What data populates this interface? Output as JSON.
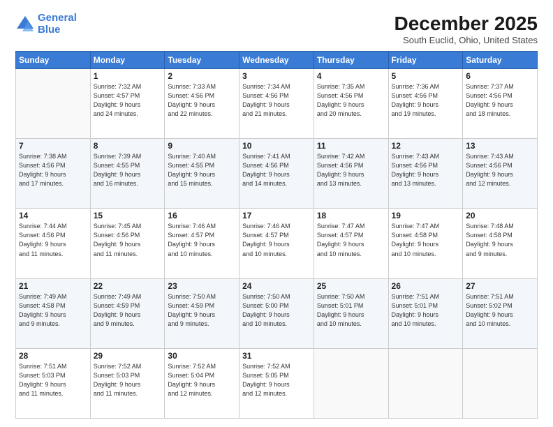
{
  "logo": {
    "line1": "General",
    "line2": "Blue"
  },
  "title": "December 2025",
  "subtitle": "South Euclid, Ohio, United States",
  "days_of_week": [
    "Sunday",
    "Monday",
    "Tuesday",
    "Wednesday",
    "Thursday",
    "Friday",
    "Saturday"
  ],
  "weeks": [
    [
      {
        "day": "",
        "text": ""
      },
      {
        "day": "1",
        "text": "Sunrise: 7:32 AM\nSunset: 4:57 PM\nDaylight: 9 hours\nand 24 minutes."
      },
      {
        "day": "2",
        "text": "Sunrise: 7:33 AM\nSunset: 4:56 PM\nDaylight: 9 hours\nand 22 minutes."
      },
      {
        "day": "3",
        "text": "Sunrise: 7:34 AM\nSunset: 4:56 PM\nDaylight: 9 hours\nand 21 minutes."
      },
      {
        "day": "4",
        "text": "Sunrise: 7:35 AM\nSunset: 4:56 PM\nDaylight: 9 hours\nand 20 minutes."
      },
      {
        "day": "5",
        "text": "Sunrise: 7:36 AM\nSunset: 4:56 PM\nDaylight: 9 hours\nand 19 minutes."
      },
      {
        "day": "6",
        "text": "Sunrise: 7:37 AM\nSunset: 4:56 PM\nDaylight: 9 hours\nand 18 minutes."
      }
    ],
    [
      {
        "day": "7",
        "text": "Sunrise: 7:38 AM\nSunset: 4:56 PM\nDaylight: 9 hours\nand 17 minutes."
      },
      {
        "day": "8",
        "text": "Sunrise: 7:39 AM\nSunset: 4:55 PM\nDaylight: 9 hours\nand 16 minutes."
      },
      {
        "day": "9",
        "text": "Sunrise: 7:40 AM\nSunset: 4:55 PM\nDaylight: 9 hours\nand 15 minutes."
      },
      {
        "day": "10",
        "text": "Sunrise: 7:41 AM\nSunset: 4:56 PM\nDaylight: 9 hours\nand 14 minutes."
      },
      {
        "day": "11",
        "text": "Sunrise: 7:42 AM\nSunset: 4:56 PM\nDaylight: 9 hours\nand 13 minutes."
      },
      {
        "day": "12",
        "text": "Sunrise: 7:43 AM\nSunset: 4:56 PM\nDaylight: 9 hours\nand 13 minutes."
      },
      {
        "day": "13",
        "text": "Sunrise: 7:43 AM\nSunset: 4:56 PM\nDaylight: 9 hours\nand 12 minutes."
      }
    ],
    [
      {
        "day": "14",
        "text": "Sunrise: 7:44 AM\nSunset: 4:56 PM\nDaylight: 9 hours\nand 11 minutes."
      },
      {
        "day": "15",
        "text": "Sunrise: 7:45 AM\nSunset: 4:56 PM\nDaylight: 9 hours\nand 11 minutes."
      },
      {
        "day": "16",
        "text": "Sunrise: 7:46 AM\nSunset: 4:57 PM\nDaylight: 9 hours\nand 10 minutes."
      },
      {
        "day": "17",
        "text": "Sunrise: 7:46 AM\nSunset: 4:57 PM\nDaylight: 9 hours\nand 10 minutes."
      },
      {
        "day": "18",
        "text": "Sunrise: 7:47 AM\nSunset: 4:57 PM\nDaylight: 9 hours\nand 10 minutes."
      },
      {
        "day": "19",
        "text": "Sunrise: 7:47 AM\nSunset: 4:58 PM\nDaylight: 9 hours\nand 10 minutes."
      },
      {
        "day": "20",
        "text": "Sunrise: 7:48 AM\nSunset: 4:58 PM\nDaylight: 9 hours\nand 9 minutes."
      }
    ],
    [
      {
        "day": "21",
        "text": "Sunrise: 7:49 AM\nSunset: 4:58 PM\nDaylight: 9 hours\nand 9 minutes."
      },
      {
        "day": "22",
        "text": "Sunrise: 7:49 AM\nSunset: 4:59 PM\nDaylight: 9 hours\nand 9 minutes."
      },
      {
        "day": "23",
        "text": "Sunrise: 7:50 AM\nSunset: 4:59 PM\nDaylight: 9 hours\nand 9 minutes."
      },
      {
        "day": "24",
        "text": "Sunrise: 7:50 AM\nSunset: 5:00 PM\nDaylight: 9 hours\nand 10 minutes."
      },
      {
        "day": "25",
        "text": "Sunrise: 7:50 AM\nSunset: 5:01 PM\nDaylight: 9 hours\nand 10 minutes."
      },
      {
        "day": "26",
        "text": "Sunrise: 7:51 AM\nSunset: 5:01 PM\nDaylight: 9 hours\nand 10 minutes."
      },
      {
        "day": "27",
        "text": "Sunrise: 7:51 AM\nSunset: 5:02 PM\nDaylight: 9 hours\nand 10 minutes."
      }
    ],
    [
      {
        "day": "28",
        "text": "Sunrise: 7:51 AM\nSunset: 5:03 PM\nDaylight: 9 hours\nand 11 minutes."
      },
      {
        "day": "29",
        "text": "Sunrise: 7:52 AM\nSunset: 5:03 PM\nDaylight: 9 hours\nand 11 minutes."
      },
      {
        "day": "30",
        "text": "Sunrise: 7:52 AM\nSunset: 5:04 PM\nDaylight: 9 hours\nand 12 minutes."
      },
      {
        "day": "31",
        "text": "Sunrise: 7:52 AM\nSunset: 5:05 PM\nDaylight: 9 hours\nand 12 minutes."
      },
      {
        "day": "",
        "text": ""
      },
      {
        "day": "",
        "text": ""
      },
      {
        "day": "",
        "text": ""
      }
    ]
  ]
}
